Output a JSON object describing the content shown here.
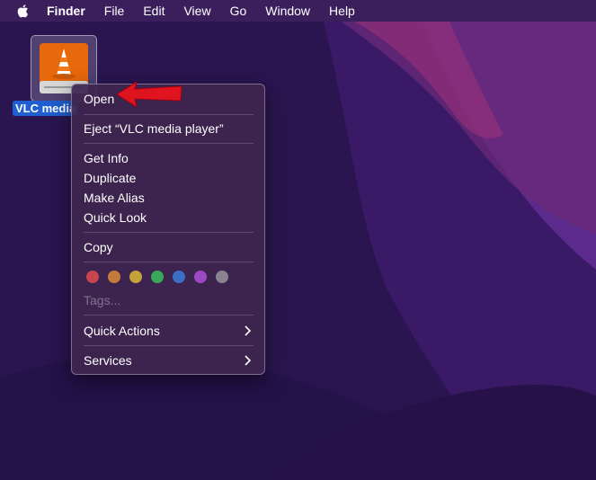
{
  "menubar": {
    "apple_icon": "apple-icon",
    "items": [
      "Finder",
      "File",
      "Edit",
      "View",
      "Go",
      "Window",
      "Help"
    ]
  },
  "desktop": {
    "drive_label": "VLC media"
  },
  "context_menu": {
    "open": "Open",
    "eject": "Eject “VLC media player”",
    "get_info": "Get Info",
    "duplicate": "Duplicate",
    "make_alias": "Make Alias",
    "quick_look": "Quick Look",
    "copy": "Copy",
    "tag_colors": [
      "#c8444f",
      "#c47a3a",
      "#c4a13a",
      "#3aa85a",
      "#3a6fc4",
      "#9b4ac4",
      "#8a8290"
    ],
    "tags_placeholder": "Tags...",
    "quick_actions": "Quick Actions",
    "services": "Services"
  },
  "colors": {
    "menubar": "#3b1f5c",
    "selection": "#1f5fd1",
    "annotation_arrow": "#e0141e"
  }
}
